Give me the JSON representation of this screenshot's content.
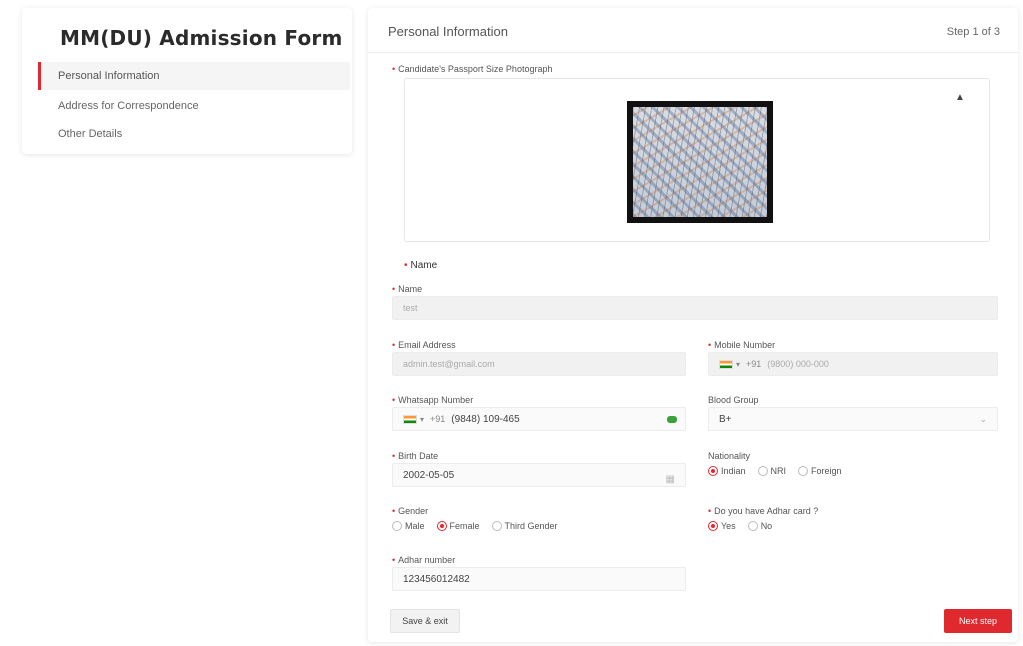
{
  "sidebar": {
    "title": "MM(DU) Admission Form",
    "items": [
      {
        "label": "Personal Information",
        "active": true
      },
      {
        "label": "Address for Correspondence",
        "active": false
      },
      {
        "label": "Other Details",
        "active": false
      }
    ]
  },
  "main": {
    "title": "Personal Information",
    "step": "Step 1 of 3",
    "photo_label": "Candidate's Passport Size Photograph",
    "collapse_icon": "chevron-up-icon",
    "section_name": "Name",
    "name": {
      "label": "Name",
      "value": "test"
    },
    "email": {
      "label": "Email Address",
      "value": "admin.test@gmail.com"
    },
    "mobile": {
      "label": "Mobile Number",
      "dial": "+91",
      "value": "(9800) 000-000"
    },
    "whatsapp": {
      "label": "Whatsapp Number",
      "dial": "+91",
      "value": "(9848) 109-465"
    },
    "blood_group": {
      "label": "Blood Group",
      "value": "B+"
    },
    "birth_date": {
      "label": "Birth Date",
      "value": "2002-05-05"
    },
    "nationality": {
      "label": "Nationality",
      "options": [
        "Indian",
        "NRI",
        "Foreign"
      ],
      "selected": "Indian"
    },
    "gender": {
      "label": "Gender",
      "options": [
        "Male",
        "Female",
        "Third Gender"
      ],
      "selected": "Female"
    },
    "aadhar_card": {
      "label": "Do you have Adhar card ?",
      "options": [
        "Yes",
        "No"
      ],
      "selected": "Yes"
    },
    "aadhar_number": {
      "label": "Adhar number",
      "value": "123456012482"
    },
    "save_label": "Save & exit",
    "next_label": "Next step"
  },
  "colors": {
    "accent": "#e0292f",
    "success": "#3aa23a"
  }
}
